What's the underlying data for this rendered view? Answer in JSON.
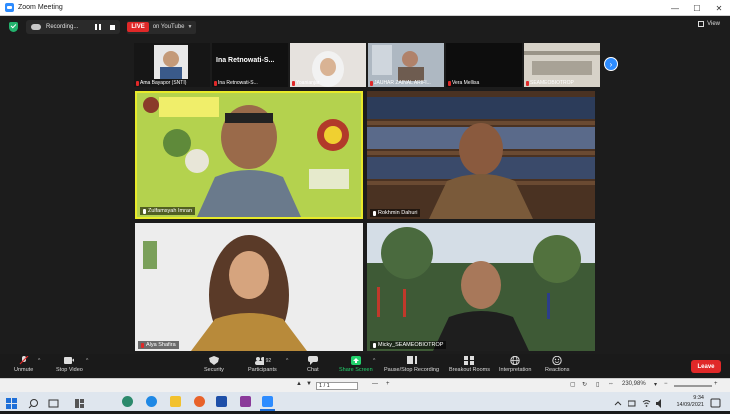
{
  "window": {
    "title": "Zoom Meeting",
    "controls": [
      "—",
      "☐",
      "✕"
    ]
  },
  "topbar": {
    "recording_label": "Recording...",
    "live_badge": "LIVE",
    "live_target": "on YouTube",
    "view_label": "View"
  },
  "strip": {
    "items": [
      {
        "name": "Ama Bayapor (SNTI)"
      },
      {
        "name": "Ina Retnowati-S...",
        "overlay": "Ina  Retnowati-S..."
      },
      {
        "name": "Yoanianjar"
      },
      {
        "name": "JAUHAR ZAINAL ARIFI..."
      },
      {
        "name": "Vera Mellisa"
      },
      {
        "name": "SEAMEOBIOTROP"
      }
    ],
    "next_arrow": "›"
  },
  "tiles": [
    {
      "name": "Zulfamsyah Imran"
    },
    {
      "name": "Rokhmin Dahuri"
    },
    {
      "name": "Alya Shafira"
    },
    {
      "name": "Micky_SEAMEOBIOTROP"
    }
  ],
  "toolbar": {
    "unmute": "Unmute",
    "stop_video": "Stop Video",
    "security": "Security",
    "participants": "Participants",
    "participants_count": "92",
    "chat": "Chat",
    "share_screen": "Share Screen",
    "recording": "Pause/Stop Recording",
    "breakout": "Breakout Rooms",
    "interpretation": "Interpretation",
    "reactions": "Reactions",
    "leave": "Leave"
  },
  "pdfbar": {
    "page": "1 / 1",
    "zoom": "230,98%"
  },
  "taskbar": {
    "time": "9:34",
    "date": "14/09/2021"
  },
  "colors": {
    "accent": "#2d8cff",
    "live": "#e02828",
    "active_speaker": "#e8ea2a",
    "share_green": "#23d26d"
  }
}
